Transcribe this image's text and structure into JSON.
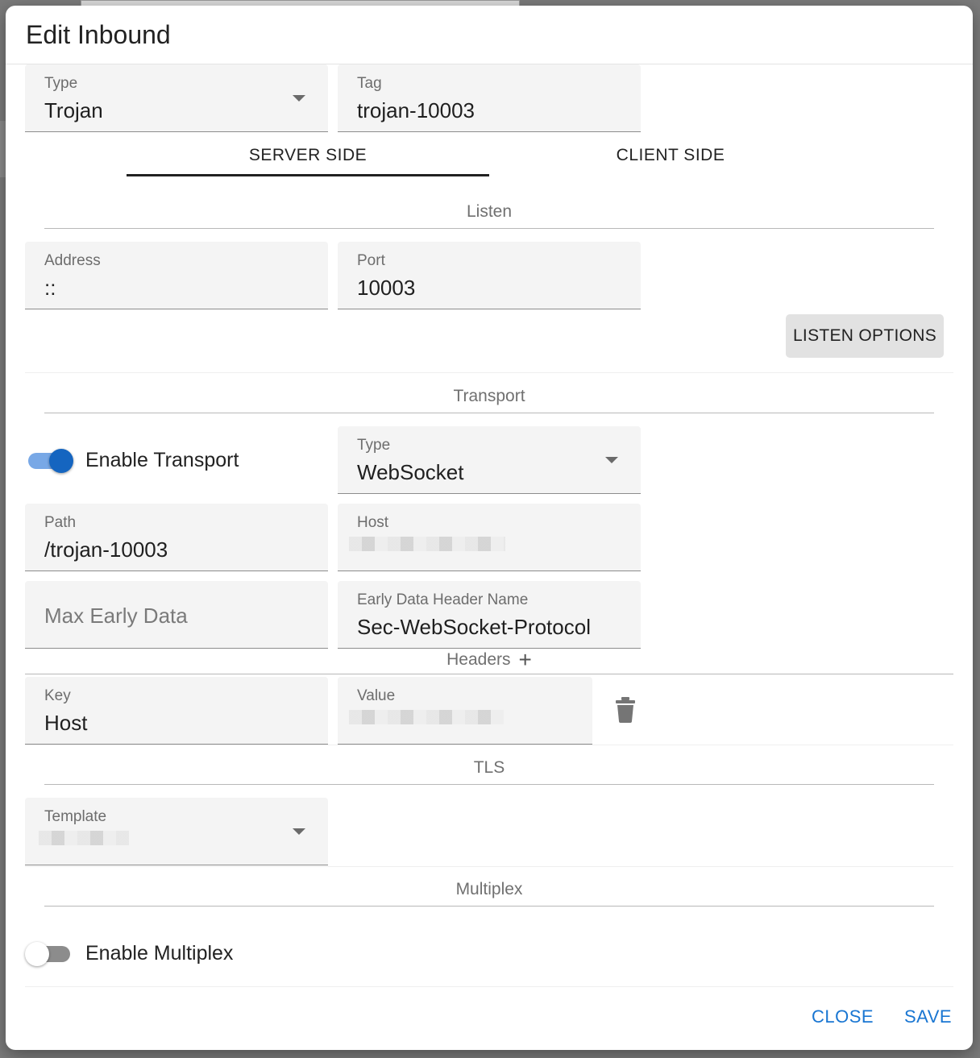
{
  "dialog": {
    "title": "Edit Inbound",
    "close_label": "CLOSE",
    "save_label": "SAVE"
  },
  "general": {
    "type_label": "Type",
    "type_value": "Trojan",
    "tag_label": "Tag",
    "tag_value": "trojan-10003"
  },
  "tabs": [
    {
      "label": "SERVER SIDE",
      "active": true
    },
    {
      "label": "CLIENT SIDE",
      "active": false
    }
  ],
  "listen": {
    "section_title": "Listen",
    "address_label": "Address",
    "address_value": "::",
    "port_label": "Port",
    "port_value": "10003",
    "options_button": "LISTEN OPTIONS"
  },
  "transport": {
    "section_title": "Transport",
    "enable_label": "Enable Transport",
    "enabled": true,
    "type_label": "Type",
    "type_value": "WebSocket",
    "path_label": "Path",
    "path_value": "/trojan-10003",
    "host_label": "Host",
    "max_early_data_placeholder": "Max Early Data",
    "early_data_header_label": "Early Data Header Name",
    "early_data_header_value": "Sec-WebSocket-Protocol",
    "headers_title": "Headers",
    "header_key_label": "Key",
    "header_key_value": "Host",
    "header_value_label": "Value"
  },
  "tls": {
    "section_title": "TLS",
    "template_label": "Template"
  },
  "multiplex": {
    "section_title": "Multiplex",
    "enable_label": "Enable Multiplex",
    "enabled": false
  },
  "colors": {
    "accent": "#1976d2",
    "switch_on_thumb": "#1565c0",
    "switch_on_track": "#78a8e6"
  }
}
